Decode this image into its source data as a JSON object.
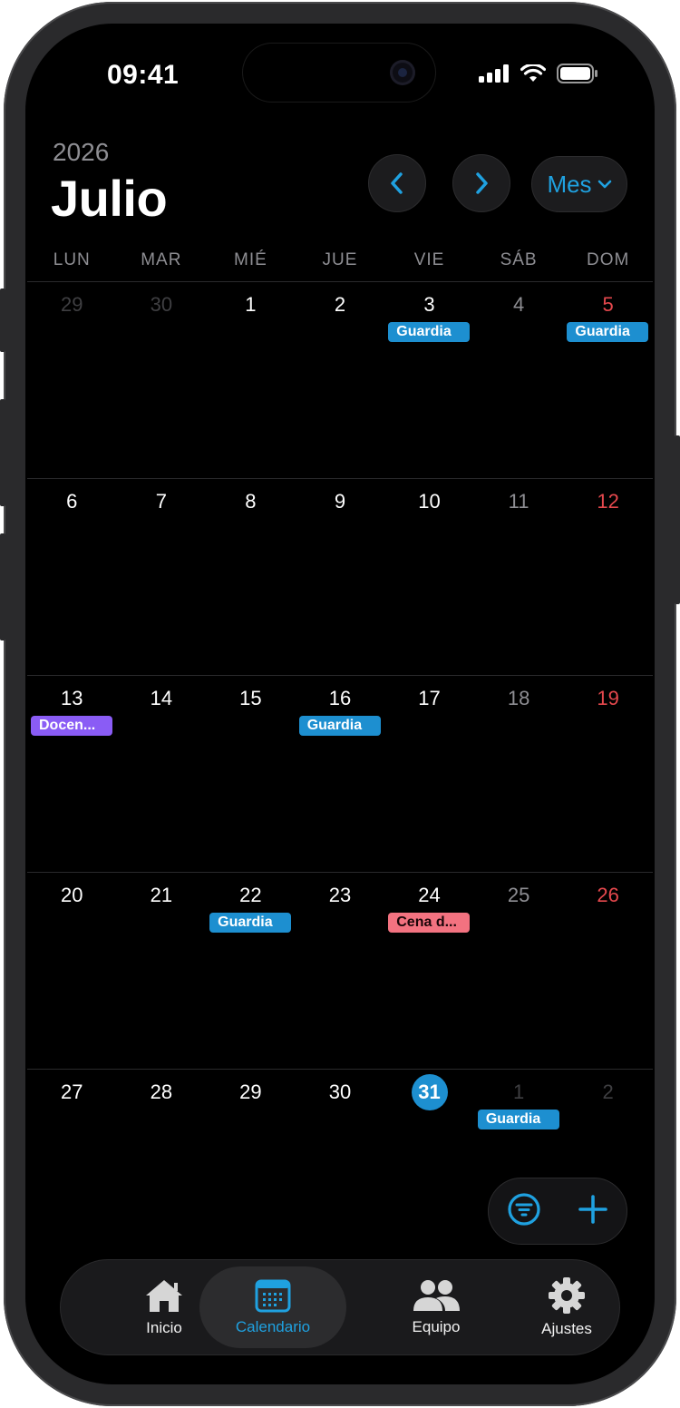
{
  "status_bar": {
    "time": "09:41"
  },
  "header": {
    "year": "2026",
    "month": "Julio",
    "view_label": "Mes"
  },
  "weekdays": [
    "LUN",
    "MAR",
    "MIÉ",
    "JUE",
    "VIE",
    "SÁB",
    "DOM"
  ],
  "weeks": [
    [
      {
        "n": "29",
        "t": "muted"
      },
      {
        "n": "30",
        "t": "muted"
      },
      {
        "n": "1"
      },
      {
        "n": "2"
      },
      {
        "n": "3",
        "ev": "Guardia",
        "c": "blue"
      },
      {
        "n": "4",
        "t": "sat"
      },
      {
        "n": "5",
        "t": "sun",
        "ev": "Guardia",
        "c": "blue"
      }
    ],
    [
      {
        "n": "6"
      },
      {
        "n": "7"
      },
      {
        "n": "8"
      },
      {
        "n": "9"
      },
      {
        "n": "10"
      },
      {
        "n": "11",
        "t": "sat"
      },
      {
        "n": "12",
        "t": "sun"
      }
    ],
    [
      {
        "n": "13",
        "ev": "Docen...",
        "c": "purple"
      },
      {
        "n": "14"
      },
      {
        "n": "15"
      },
      {
        "n": "16",
        "ev": "Guardia",
        "c": "blue"
      },
      {
        "n": "17"
      },
      {
        "n": "18",
        "t": "sat"
      },
      {
        "n": "19",
        "t": "sun"
      }
    ],
    [
      {
        "n": "20"
      },
      {
        "n": "21"
      },
      {
        "n": "22",
        "ev": "Guardia",
        "c": "blue"
      },
      {
        "n": "23"
      },
      {
        "n": "24",
        "ev": "Cena d...",
        "c": "pink"
      },
      {
        "n": "25",
        "t": "sat"
      },
      {
        "n": "26",
        "t": "sun"
      }
    ],
    [
      {
        "n": "27"
      },
      {
        "n": "28"
      },
      {
        "n": "29"
      },
      {
        "n": "30"
      },
      {
        "n": "31",
        "t": "today"
      },
      {
        "n": "1",
        "t": "muted",
        "ev": "Guardia",
        "c": "blue"
      },
      {
        "n": "2",
        "t": "muted"
      }
    ]
  ],
  "tabs": [
    {
      "label": "Inicio",
      "icon": "house-icon"
    },
    {
      "label": "Calendario",
      "icon": "calendar-icon",
      "active": true
    },
    {
      "label": "Equipo",
      "icon": "people-icon"
    },
    {
      "label": "Ajustes",
      "icon": "gear-icon"
    }
  ],
  "colors": {
    "accent": "#1fa1e0",
    "event_blue": "#1d8fd0",
    "event_purple": "#8a5cf5",
    "event_pink": "#f37280",
    "sunday": "#e5484d"
  }
}
